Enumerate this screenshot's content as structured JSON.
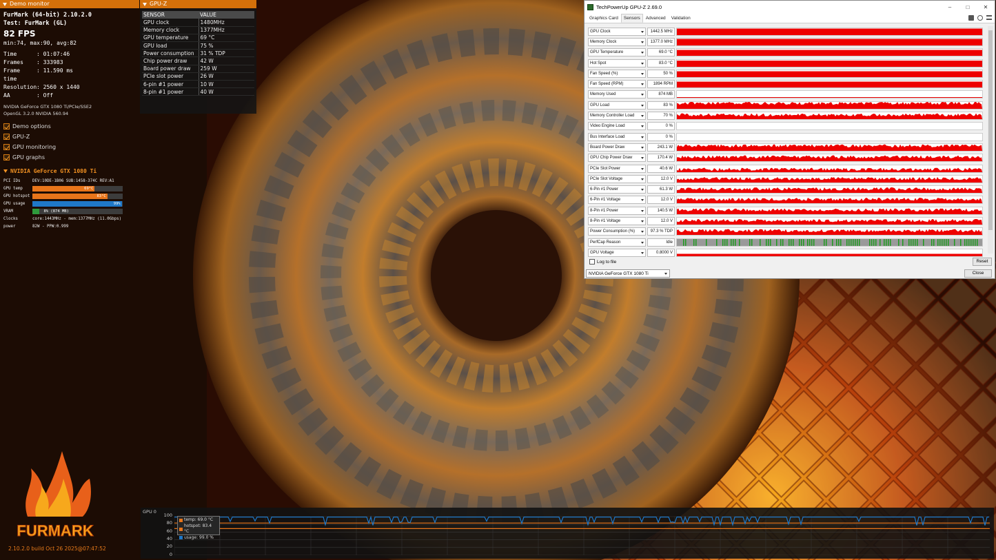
{
  "demo_monitor": {
    "header": "Demo monitor",
    "app": "FurMark (64-bit) 2.10.2.0",
    "test": "Test: FurMark (GL)",
    "fps": "82 FPS",
    "minmax": "min:74, max:90, avg:82",
    "stats": [
      {
        "k": "Time",
        "v": ": 01:07:46"
      },
      {
        "k": "Frames",
        "v": ": 333983"
      },
      {
        "k": "Frame time",
        "v": ": 11.590 ms"
      },
      {
        "k": "Resolution",
        "v": ": 2560 x 1440"
      },
      {
        "k": "AA",
        "v": ": Off"
      }
    ],
    "gpu_line": "NVIDIA GeForce GTX 1080 Ti/PCIe/SSE2",
    "gl_line": "OpenGL 3.2.0 NVIDIA 560.94",
    "checks": [
      "Demo options",
      "GPU-Z",
      "GPU monitoring",
      "GPU graphs"
    ],
    "gpu_name": "NVIDIA GeForce GTX 1080 Ti",
    "pci_label": "PCI IDs",
    "pci_value": "DEV:10DE-1B06 SUB:1458-374C REV:A1",
    "bars": [
      {
        "k": "GPU temp",
        "label": "69°C",
        "fraction": 0.69,
        "color": "#e8751a"
      },
      {
        "k": "GPU hotspot",
        "label": "83°C",
        "fraction": 0.83,
        "color": "#e8751a"
      },
      {
        "k": "GPU usage",
        "label": "99%",
        "fraction": 0.99,
        "color": "#1f78c8"
      },
      {
        "k": "VRAM",
        "label": "8% (874 MB)",
        "fraction": 0.08,
        "color": "#2e9a3c"
      }
    ],
    "clocks_label": "Clocks",
    "clocks_value": "core:1443MHz - mem:1377MHz (11.0Gbps)",
    "power_label": "power",
    "power_value": "82W - PPW:0.999",
    "logo_text": "FURMARK",
    "build": "2.10.2.0 build Oct 26 2025@07:47:52"
  },
  "gpuz_overlay": {
    "header": "GPU-Z",
    "col_sensor": "SENSOR",
    "col_value": "VALUE",
    "rows": [
      {
        "s": "GPU clock",
        "v": "1480MHz"
      },
      {
        "s": "Memory clock",
        "v": "1377MHz"
      },
      {
        "s": "GPU temperature",
        "v": "69 °C"
      },
      {
        "s": "GPU load",
        "v": "75 %"
      },
      {
        "s": "Power consumption",
        "v": "31 % TDP"
      },
      {
        "s": "Chip power draw",
        "v": "42 W"
      },
      {
        "s": "Board power draw",
        "v": "259 W"
      },
      {
        "s": "PCIe slot power",
        "v": "26 W"
      },
      {
        "s": "6-pin #1 power",
        "v": "10 W"
      },
      {
        "s": "8-pin #1 power",
        "v": "40 W"
      }
    ]
  },
  "gpuz_window": {
    "title": "TechPowerUp GPU-Z 2.69.0",
    "tabs": [
      "Graphics Card",
      "Sensors",
      "Advanced",
      "Validation"
    ],
    "active_tab": 1,
    "sensors": [
      {
        "name": "GPU Clock",
        "value": "1442.5 MHz",
        "level": 0.95,
        "kind": "flat"
      },
      {
        "name": "Memory Clock",
        "value": "1377.0 MHz",
        "level": 0.95,
        "kind": "flat"
      },
      {
        "name": "GPU Temperature",
        "value": "69.0 °C",
        "level": 0.85,
        "kind": "flat"
      },
      {
        "name": "Hot Spot",
        "value": "83.0 °C",
        "level": 0.9,
        "kind": "flat"
      },
      {
        "name": "Fan Speed (%)",
        "value": "50 %",
        "level": 0.85,
        "kind": "flat"
      },
      {
        "name": "Fan Speed (RPM)",
        "value": "1894 RPM",
        "level": 0.85,
        "kind": "flat"
      },
      {
        "name": "Memory Used",
        "value": "874 MB",
        "level": 0.08,
        "kind": "flat"
      },
      {
        "name": "GPU Load",
        "value": "83 %",
        "level": 0.8,
        "kind": "noisy"
      },
      {
        "name": "Memory Controller Load",
        "value": "70 %",
        "level": 0.6,
        "kind": "noisy"
      },
      {
        "name": "Video Engine Load",
        "value": "0 %",
        "level": 0,
        "kind": "none"
      },
      {
        "name": "Bus Interface Load",
        "value": "0 %",
        "level": 0,
        "kind": "none"
      },
      {
        "name": "Board Power Draw",
        "value": "243.1 W",
        "level": 0.7,
        "kind": "noisy"
      },
      {
        "name": "GPU Chip Power Draw",
        "value": "170.4 W",
        "level": 0.6,
        "kind": "noisy"
      },
      {
        "name": "PCIe Slot Power",
        "value": "40.6 W",
        "level": 0.4,
        "kind": "noisy"
      },
      {
        "name": "PCIe Slot Voltage",
        "value": "12.0 V",
        "level": 0.55,
        "kind": "noisy"
      },
      {
        "name": "6-Pin #1 Power",
        "value": "61.3 W",
        "level": 0.55,
        "kind": "noisy"
      },
      {
        "name": "6-Pin #1 Voltage",
        "value": "12.0 V",
        "level": 0.55,
        "kind": "noisy"
      },
      {
        "name": "8-Pin #1 Power",
        "value": "140.5 W",
        "level": 0.6,
        "kind": "noisy"
      },
      {
        "name": "8-Pin #1 Voltage",
        "value": "12.0 V",
        "level": 0.55,
        "kind": "noisy"
      },
      {
        "name": "Power Consumption (%)",
        "value": "97.3 % TDP",
        "level": 0.6,
        "kind": "noisy"
      },
      {
        "name": "PerfCap Reason",
        "value": "Idle",
        "level": 1,
        "kind": "perfcap"
      },
      {
        "name": "GPU Voltage",
        "value": "0.8000 V",
        "level": 0.35,
        "kind": "flat"
      }
    ],
    "log_to_file": "Log to file",
    "reset": "Reset",
    "gpu_select": "NVIDIA GeForce GTX 1080 Ti",
    "close": "Close"
  },
  "bottom_graph": {
    "title": "GPU 0",
    "y_ticks": [
      "100",
      "80",
      "60",
      "40",
      "20",
      "0"
    ],
    "legend": [
      {
        "label": "temp: 69.0 °C",
        "color": "#e8751a"
      },
      {
        "label": "hotspot: 83.4 °C",
        "color": "#e8751a"
      },
      {
        "label": "usage: 99.0 %",
        "color": "#1f78c8"
      }
    ],
    "series_levels": {
      "temp": 69.0,
      "hotspot": 83.4,
      "usage": 99.0
    }
  }
}
